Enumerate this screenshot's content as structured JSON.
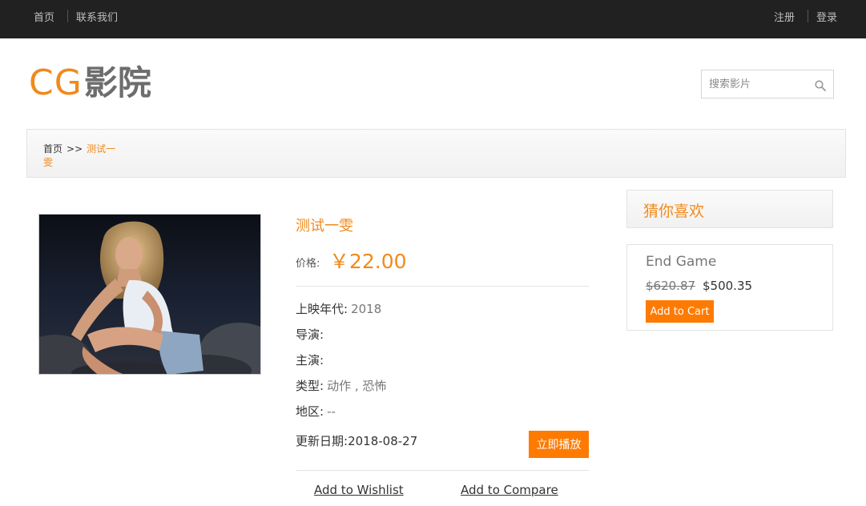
{
  "topbar": {
    "home": "首页",
    "contact": "联系我们",
    "register": "注册",
    "login": "登录"
  },
  "logo": {
    "latin": "CG",
    "chinese": "影院"
  },
  "search": {
    "placeholder": "搜索影片"
  },
  "breadcrumb": {
    "home": "首页",
    "separator": ">>",
    "current": "测试一 雯"
  },
  "movie": {
    "title": "测试一雯",
    "price_label": "价格:",
    "price": "￥22.00",
    "year_label": "上映年代:",
    "year": "2018",
    "director_label": "导演:",
    "director": "",
    "cast_label": "主演:",
    "cast": "",
    "genre_label": "类型:",
    "genre": "动作 , 恐怖",
    "region_label": "地区:",
    "region": "--",
    "updated_label": "更新日期:",
    "updated": "2018-08-27",
    "play_button": "立即播放",
    "wishlist": "Add to Wishlist",
    "compare": "Add to Compare"
  },
  "sidebar": {
    "heading": "猜你喜欢",
    "item": {
      "name": "End Game",
      "old_price": "$620.87",
      "new_price": "$500.35",
      "cart_button": "Add to Cart"
    }
  },
  "colors": {
    "accent": "#f08a1c",
    "button": "#ff7a00",
    "topbar": "#212121"
  },
  "icons": {
    "search": "search-icon"
  }
}
